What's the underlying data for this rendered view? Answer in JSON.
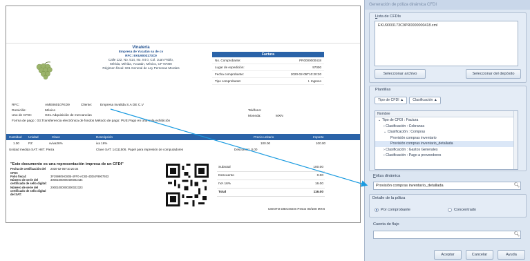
{
  "invoice": {
    "company_name": "Vinatería",
    "company_legal": "Empresa de Yucatán sa de cv",
    "company_rfc": "RFC: EKU9003173C9",
    "company_addr1": "Calle 122, No. 514, No. Int 0, Col. Juan Pablo,",
    "company_addr2": "Mérida, Mérida, Yucatán, México, CP 97000",
    "company_regime": "Régimen fiscal: 601 General de Ley Personas Morales",
    "factura_title": "Factura",
    "factura_rows": [
      {
        "label": "No. Comprobante:",
        "value": "PR0000000418"
      },
      {
        "label": "Lugar de expedición:",
        "value": "97000"
      },
      {
        "label": "Fecha comprobante:",
        "value": "2020-02-05T10:20:30"
      },
      {
        "label": "Tipo comprobante:",
        "value": "I. Ingreso"
      }
    ],
    "client": {
      "rfc_label": "RFC:",
      "rfc_value": "AME860107KD9",
      "client_label": "Cliente:",
      "client_value": "Empresa invalida S.A DE C.V",
      "domicilio_label": "Domicilio:",
      "domicilio_value": "México",
      "uso_label": "Uso de CFDI:",
      "uso_value": "G01.Adquisición de mercancías",
      "forma_pago": "Forma de pago : 03.Transferencia electrónica de fondos  Método de pago: PUE.Pago en una sola exhibición",
      "telefono_label": "Teléfono:",
      "telefono_value": "",
      "moneda_label": "Moneda:",
      "moneda_value": "MXN"
    },
    "table_headers": [
      "Cantidad",
      "Unidad",
      "Clave",
      "Descripción",
      "Precio unitario",
      "Importe"
    ],
    "table_row1": [
      "1.00",
      "PZ",
      "vviva26%",
      "iva 16%",
      "100.00",
      "100.00"
    ],
    "table_row2_unit": "Unidad medida SAT: H87: Pieza",
    "table_row2_desc": "Clave SAT: 14111506. Papel para impresión de computadores",
    "table_row2_desc_line2": "computadores",
    "table_row2_discount": "Descuento: 0.00",
    "sat_title": "\"Este documento es una representación impresa de un CFDI\"",
    "sat_rows": [
      {
        "k": "Fecha de certificación del CFDI:",
        "v": "2020-02-05T10:20:34"
      },
      {
        "k": "Folio fiscal:",
        "v": "3F299909-D805-4FF0-AC83-4DD4F9907933"
      },
      {
        "k": "Número de serie del certificado de sello digital:",
        "v": "30001000000400002434"
      },
      {
        "k": "Número de serie del certificado de sello digital del SAT:",
        "v": "20001000000300022323"
      }
    ],
    "totals": [
      {
        "label": "Subtotal",
        "value": "100.00"
      },
      {
        "label": "Descuento",
        "value": "0.00"
      },
      {
        "label": "IVA 16%",
        "value": "16.00"
      },
      {
        "label": "Total",
        "value": "116.00"
      }
    ],
    "amount_words": "CIENTO DIECISEIS Pesos 00/100 MXN"
  },
  "dialog": {
    "title": "Generación de póliza dinámica CFDI",
    "lista_label": "Lista de CFDIs",
    "cfdi_files": [
      "EKU9003173C9PR0000000418.xml"
    ],
    "btn_seleccionar_archivo": "Seleccionar archivo",
    "btn_seleccionar_deposito": "Seleccionar del depósito",
    "plantillas_label": "Plantillas",
    "tab_tipo": "Tipo de CFDI ▲",
    "tab_clasificacion": "Clasificación ▲",
    "tree_header": "Nombre",
    "tree_items": [
      {
        "text": "⌄  Tipo de CFDI : Factura",
        "indent": 1
      },
      {
        "text": "›  Clasificación : Cobranza",
        "indent": 2
      },
      {
        "text": "⌄  Clasificación : Compras",
        "indent": 2
      },
      {
        "text": "Provisión compras inventario",
        "indent": 3
      },
      {
        "text": "Provisión compras inventario_detallada",
        "indent": 3
      },
      {
        "text": "›  Clasificación : Gastos Generales",
        "indent": 2
      },
      {
        "text": "›  Clasificación : Pago a proveedores",
        "indent": 2
      }
    ],
    "poliza_label": "Póliza dinámica",
    "poliza_value": "Provisión compras inventario_detallada",
    "detalle_label": "Detalle de la póliza",
    "radio_por_comprobante": "Por comprobante",
    "radio_concentrado": "Concentrado",
    "cuenta_flujo_label": "Cuenta de flujo",
    "cuenta_flujo_value": "",
    "btn_aceptar": "Aceptar",
    "btn_cancelar": "Cancelar",
    "btn_ayuda": "Ayuda"
  },
  "colors": {
    "accent": "#2a63a8",
    "arrow": "#1a9be0",
    "dialog_bg": "#dce6f2"
  }
}
